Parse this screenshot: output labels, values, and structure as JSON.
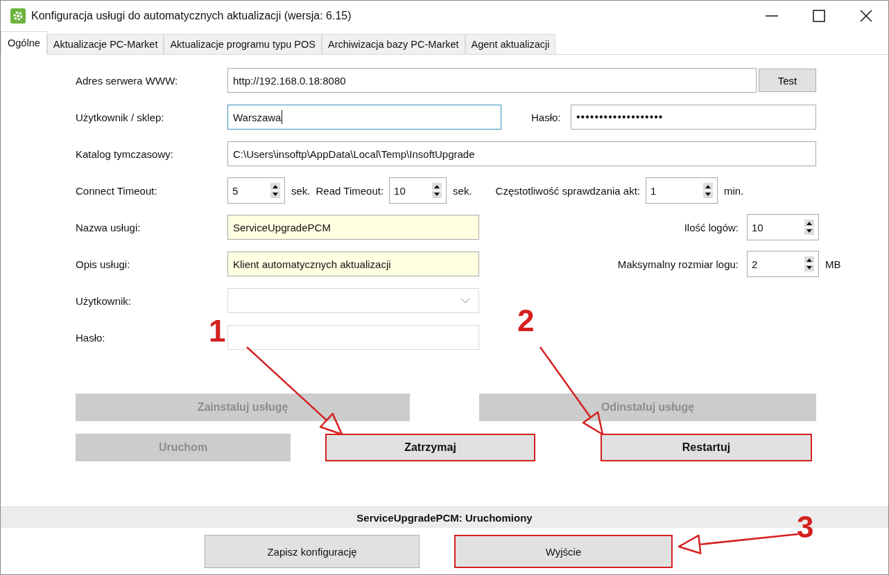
{
  "window": {
    "title": "Konfiguracja usługi do automatycznych aktualizacji (wersja: 6.15)"
  },
  "tabs": [
    {
      "label": "Ogólne",
      "selected": true
    },
    {
      "label": "Aktualizacje PC-Market",
      "selected": false
    },
    {
      "label": "Aktualizacje programu typu POS",
      "selected": false
    },
    {
      "label": "Archiwizacja bazy PC-Market",
      "selected": false
    },
    {
      "label": "Agent aktualizacji",
      "selected": false
    }
  ],
  "server": {
    "label": "Adres serwera WWW:",
    "value": "http://192.168.0.18:8080",
    "button": "Test"
  },
  "user": {
    "label": "Użytkownik / sklep:",
    "value": "Warszawa",
    "focused": true
  },
  "password": {
    "label": "Hasło:",
    "value": "•••••••••••••••••••"
  },
  "temp_dir": {
    "label": "Katalog tymczasowy:",
    "value": "C:\\Users\\insoftp\\AppData\\Local\\Temp\\InsoftUpgrade"
  },
  "timeouts": [
    {
      "label": "Connect Timeout:",
      "value": "5",
      "unit": "sek."
    },
    {
      "label": "Read Timeout:",
      "value": "10",
      "unit": "sek."
    },
    {
      "label": "Częstotliwość sprawdzania akt:",
      "value": "1",
      "unit": "min."
    }
  ],
  "service_name": {
    "label": "Nazwa usługi:",
    "value": "ServiceUpgradePCM"
  },
  "service_desc": {
    "label": "Opis usługi:",
    "value": "Klient automatycznych aktualizacji"
  },
  "log_count": {
    "label": "Ilość logów:",
    "value": "10"
  },
  "log_size": {
    "label": "Maksymalny rozmiar logu:",
    "value": "2",
    "unit": "MB"
  },
  "account_user": {
    "label": "Użytkownik:",
    "disabled": true
  },
  "account_password": {
    "label": "Hasło:"
  },
  "service_buttons": [
    [
      {
        "label": "Zainstaluj usługę",
        "disabled": true,
        "highlighted": false
      },
      {
        "label": "Odinstaluj usługę",
        "disabled": true,
        "highlighted": false
      }
    ],
    [
      {
        "label": "Uruchom",
        "disabled": true,
        "highlighted": false
      },
      {
        "label": "Zatrzymaj",
        "disabled": false,
        "highlighted": true
      },
      {
        "label": "Restartuj",
        "disabled": false,
        "highlighted": true
      }
    ]
  ],
  "status": "ServiceUpgradePCM: Uruchomiony",
  "footer_buttons": [
    {
      "label": "Zapisz konfigurację",
      "highlighted": false
    },
    {
      "label": "Wyjście",
      "highlighted": true
    }
  ],
  "annotations": [
    "1",
    "2",
    "3"
  ]
}
